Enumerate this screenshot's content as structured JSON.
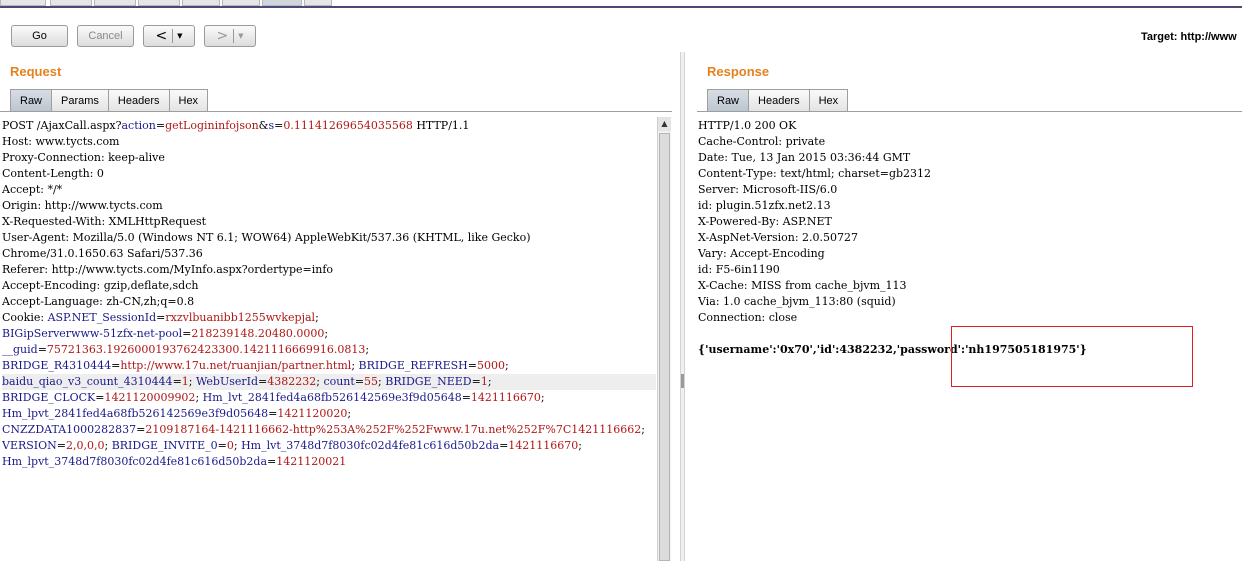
{
  "toolbar": {
    "go_label": "Go",
    "cancel_label": "Cancel",
    "back_arrow": "<",
    "forward_arrow": ">",
    "dropdown_glyph": "▼",
    "target_text": "Target: http://www"
  },
  "request": {
    "title": "Request",
    "tabs": [
      "Raw",
      "Params",
      "Headers",
      "Hex"
    ],
    "active_tab": "Raw",
    "lines": [
      [
        {
          "t": "POST /AjaxCall.aspx?",
          "c": "k"
        },
        {
          "t": "action",
          "c": "n"
        },
        {
          "t": "=",
          "c": "k"
        },
        {
          "t": "getLogininfojson",
          "c": "v"
        },
        {
          "t": "&",
          "c": "k"
        },
        {
          "t": "s",
          "c": "n"
        },
        {
          "t": "=",
          "c": "k"
        },
        {
          "t": "0.11141269654035568",
          "c": "v"
        },
        {
          "t": " HTTP/1.1",
          "c": "k"
        }
      ],
      [
        {
          "t": "Host: www.tycts.com",
          "c": "k"
        }
      ],
      [
        {
          "t": "Proxy-Connection: keep-alive",
          "c": "k"
        }
      ],
      [
        {
          "t": "Content-Length: 0",
          "c": "k"
        }
      ],
      [
        {
          "t": "Accept: */*",
          "c": "k"
        }
      ],
      [
        {
          "t": "Origin: http://www.tycts.com",
          "c": "k"
        }
      ],
      [
        {
          "t": "X-Requested-With: XMLHttpRequest",
          "c": "k"
        }
      ],
      [
        {
          "t": "User-Agent: Mozilla/5.0 (Windows NT 6.1; WOW64) AppleWebKit/537.36 (KHTML, like Gecko)",
          "c": "k"
        }
      ],
      [
        {
          "t": "Chrome/31.0.1650.63 Safari/537.36",
          "c": "k"
        }
      ],
      [
        {
          "t": "Referer: http://www.tycts.com/MyInfo.aspx?ordertype=info",
          "c": "k"
        }
      ],
      [
        {
          "t": "Accept-Encoding: gzip,deflate,sdch",
          "c": "k"
        }
      ],
      [
        {
          "t": "Accept-Language: zh-CN,zh;q=0.8",
          "c": "k"
        }
      ],
      [
        {
          "t": "Cookie: ",
          "c": "k"
        },
        {
          "t": "ASP.NET_SessionId",
          "c": "n"
        },
        {
          "t": "=",
          "c": "k"
        },
        {
          "t": "rxzvlbuanibb1255wvkepjal",
          "c": "v"
        },
        {
          "t": ";",
          "c": "k"
        }
      ],
      [
        {
          "t": "BIGipServerwww-51zfx-net-pool",
          "c": "n"
        },
        {
          "t": "=",
          "c": "k"
        },
        {
          "t": "218239148.20480.0000",
          "c": "v"
        },
        {
          "t": ";",
          "c": "k"
        }
      ],
      [
        {
          "t": "__guid",
          "c": "n"
        },
        {
          "t": "=",
          "c": "k"
        },
        {
          "t": "75721363.1926000193762423300.1421116669916.0813",
          "c": "v"
        },
        {
          "t": ";",
          "c": "k"
        }
      ],
      [
        {
          "t": "BRIDGE_R4310444",
          "c": "n"
        },
        {
          "t": "=",
          "c": "k"
        },
        {
          "t": "http://www.17u.net/ruanjian/partner.html",
          "c": "v"
        },
        {
          "t": "; ",
          "c": "k"
        },
        {
          "t": "BRIDGE_REFRESH",
          "c": "n"
        },
        {
          "t": "=",
          "c": "k"
        },
        {
          "t": "5000",
          "c": "v"
        },
        {
          "t": ";",
          "c": "k"
        }
      ],
      [
        {
          "t": "baidu_qiao_v3_count_4310444",
          "c": "n"
        },
        {
          "t": "=",
          "c": "k"
        },
        {
          "t": "1",
          "c": "v"
        },
        {
          "t": "; ",
          "c": "k"
        },
        {
          "t": "WebUserId",
          "c": "n"
        },
        {
          "t": "=",
          "c": "k"
        },
        {
          "t": "4382232",
          "c": "v"
        },
        {
          "t": "; ",
          "c": "k"
        },
        {
          "t": "count",
          "c": "n"
        },
        {
          "t": "=",
          "c": "k"
        },
        {
          "t": "55",
          "c": "v"
        },
        {
          "t": "; ",
          "c": "k"
        },
        {
          "t": "BRIDGE_NEED",
          "c": "n"
        },
        {
          "t": "=",
          "c": "k"
        },
        {
          "t": "1",
          "c": "v"
        },
        {
          "t": ";",
          "c": "k"
        }
      ],
      [
        {
          "t": "BRIDGE_CLOCK",
          "c": "n"
        },
        {
          "t": "=",
          "c": "k"
        },
        {
          "t": "1421120009902",
          "c": "v"
        },
        {
          "t": "; ",
          "c": "k"
        },
        {
          "t": "Hm_lvt_2841fed4a68fb526142569e3f9d05648",
          "c": "n"
        },
        {
          "t": "=",
          "c": "k"
        },
        {
          "t": "1421116670",
          "c": "v"
        },
        {
          "t": ";",
          "c": "k"
        }
      ],
      [
        {
          "t": "Hm_lpvt_2841fed4a68fb526142569e3f9d05648",
          "c": "n"
        },
        {
          "t": "=",
          "c": "k"
        },
        {
          "t": "1421120020",
          "c": "v"
        },
        {
          "t": ";",
          "c": "k"
        }
      ],
      [
        {
          "t": "CNZZDATA1000282837",
          "c": "n"
        },
        {
          "t": "=",
          "c": "k"
        },
        {
          "t": "2109187164-1421116662-http%253A%252F%252Fwww.17u.net%252F%7C1421116662",
          "c": "v"
        },
        {
          "t": ";",
          "c": "k"
        }
      ],
      [
        {
          "t": "VERSION",
          "c": "n"
        },
        {
          "t": "=",
          "c": "k"
        },
        {
          "t": "2,0,0,0",
          "c": "v"
        },
        {
          "t": "; ",
          "c": "k"
        },
        {
          "t": "BRIDGE_INVITE_0",
          "c": "n"
        },
        {
          "t": "=",
          "c": "k"
        },
        {
          "t": "0",
          "c": "v"
        },
        {
          "t": "; ",
          "c": "k"
        },
        {
          "t": "Hm_lvt_3748d7f8030fc02d4fe81c616d50b2da",
          "c": "n"
        },
        {
          "t": "=",
          "c": "k"
        },
        {
          "t": "1421116670",
          "c": "v"
        },
        {
          "t": ";",
          "c": "k"
        }
      ],
      [
        {
          "t": "Hm_lpvt_3748d7f8030fc02d4fe81c616d50b2da",
          "c": "n"
        },
        {
          "t": "=",
          "c": "k"
        },
        {
          "t": "1421120021",
          "c": "v"
        }
      ]
    ]
  },
  "response": {
    "title": "Response",
    "tabs": [
      "Raw",
      "Headers",
      "Hex"
    ],
    "active_tab": "Raw",
    "lines": [
      "HTTP/1.0 200 OK",
      "Cache-Control: private",
      "Date: Tue, 13 Jan 2015 03:36:44 GMT",
      "Content-Type: text/html; charset=gb2312",
      "Server: Microsoft-IIS/6.0",
      "id: plugin.51zfx.net2.13",
      "X-Powered-By: ASP.NET",
      "X-AspNet-Version: 2.0.50727",
      "Vary: Accept-Encoding",
      "id: F5-6in1190",
      "X-Cache: MISS from cache_bjvm_113",
      "Via: 1.0 cache_bjvm_113:80 (squid)",
      "Connection: close"
    ],
    "body": "{'username':'0x70','id':4382232,'password':'nh197505181975'}"
  },
  "colors": {
    "accent": "#e4821e",
    "highlight_box": "#e02020",
    "param_name": "#1a1a8c",
    "param_value": "#b01616"
  }
}
